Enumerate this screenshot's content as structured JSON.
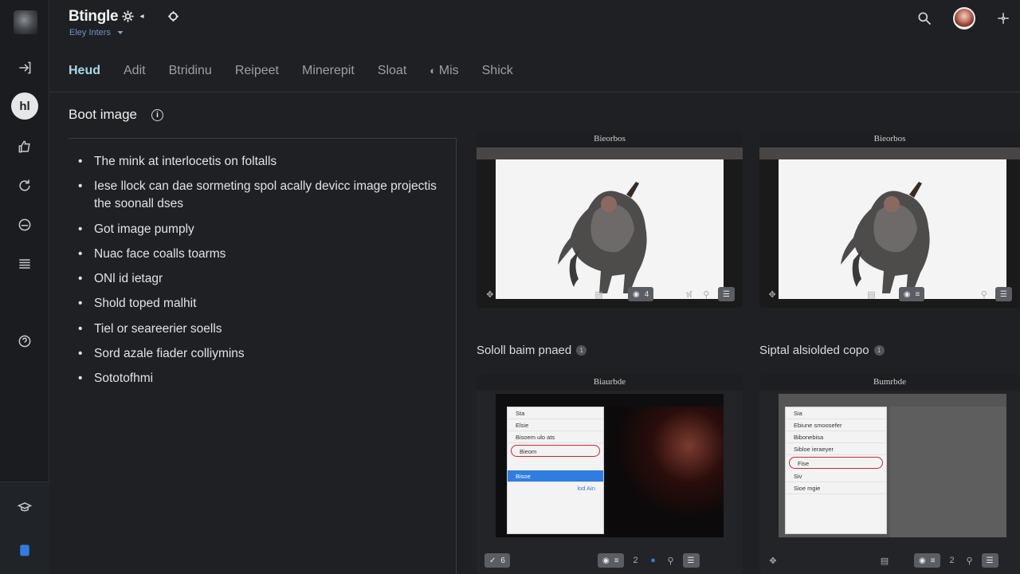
{
  "header": {
    "app_title": "Btingle",
    "subtitle": "Eley Inters"
  },
  "rail": {
    "active_label": "hl"
  },
  "tabs": [
    {
      "label": "Heud",
      "active": true
    },
    {
      "label": "Adit",
      "active": false
    },
    {
      "label": "Btridinu",
      "active": false
    },
    {
      "label": "Reipeet",
      "active": false
    },
    {
      "label": "Minerepit",
      "active": false
    },
    {
      "label": "Sloat",
      "active": false
    },
    {
      "label": "Mis",
      "active": false
    },
    {
      "label": "Shick",
      "active": false
    }
  ],
  "section": {
    "title": "Boot image",
    "info": "i"
  },
  "notes": [
    "The mink at interlocetis on foltalls",
    "Iese llock can dae sormeting spol acally devicc image projectis the soonall dses",
    "Got image pumply",
    "Nuac face coalls toarms",
    "ONl id ietagr",
    "Shold toped malhit",
    "Tiel or seareerier soells",
    "Sord azale fiader colliymins",
    "Sototofhmi"
  ],
  "cards": {
    "top_left": {
      "header": "Bieorbos",
      "caption": "Sololl baim pnaed",
      "chip": "4",
      "badge": "1"
    },
    "top_right": {
      "header": "Bieorbos",
      "caption": "Siptal alsiolded copo",
      "chip": "",
      "badge": "1"
    },
    "low_left": {
      "header": "Biaurbde",
      "dialog": {
        "title": "Sta",
        "rows": [
          "Elsie",
          "Bisoem ulo ats",
          "Bieom",
          "Bisoe"
        ],
        "link": "lod Ain"
      },
      "chips": [
        "6",
        "2"
      ]
    },
    "low_right": {
      "header": "Bumrbde",
      "dialog": {
        "title": "Sia",
        "rows": [
          "Ebiune smoosefer",
          "Bibonebisa",
          "Sibloe ieraeyer",
          "Fise",
          "Siv",
          "Sioe mgie"
        ]
      },
      "chips": [
        "2"
      ]
    }
  },
  "colors": {
    "bg": "#1e2024",
    "rail": "#1a1c20",
    "tab_active": "#a8d7e6",
    "accent_blue": "#2f7de0",
    "highlight_ring": "#d0262a"
  }
}
